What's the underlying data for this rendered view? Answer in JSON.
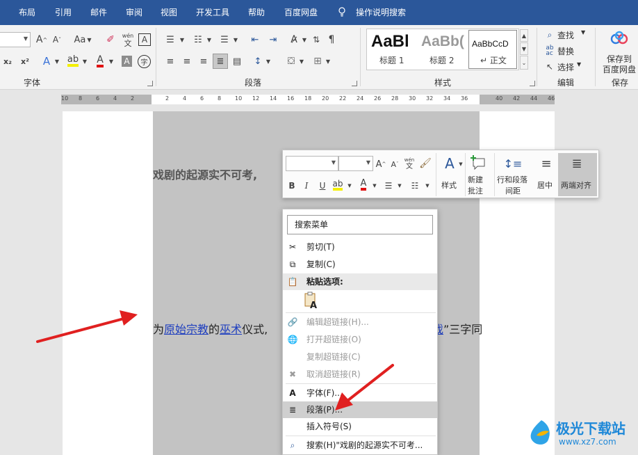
{
  "menu_tabs": [
    "布局",
    "引用",
    "邮件",
    "审阅",
    "视图",
    "开发工具",
    "帮助",
    "百度网盘"
  ],
  "tell_me": "操作说明搜索",
  "ribbon": {
    "groups": {
      "font": "字体",
      "paragraph": "段落",
      "styles": "样式",
      "editing": "编辑",
      "save": "保存"
    },
    "font_row1": {
      "grow": "A",
      "shrink": "A",
      "case": "Aa",
      "phonetic_top": "wén",
      "phonetic_bottom": "文",
      "border_char": "A"
    },
    "font_row2": {
      "subscript": "x₂",
      "superscript": "x²",
      "effects": "A",
      "font_color": "A",
      "shade": "A",
      "circle": "字"
    },
    "styles": [
      {
        "preview": "AaBl",
        "caption": "标题 1"
      },
      {
        "preview": "AaBb(",
        "caption": "标题 2"
      },
      {
        "preview": "AaBbCcD",
        "caption": "↵ 正文"
      }
    ],
    "editing": {
      "find": "查找",
      "replace": "替换",
      "select": "选择"
    },
    "save": {
      "line1": "保存到",
      "line2": "百度网盘"
    }
  },
  "ruler_ticks": [
    "10",
    "8",
    "6",
    "4",
    "2",
    "2",
    "4",
    "6",
    "8",
    "10",
    "12",
    "14",
    "16",
    "18",
    "20",
    "22",
    "24",
    "26",
    "28",
    "30",
    "32",
    "34",
    "36",
    "40",
    "42",
    "44",
    "46"
  ],
  "document": {
    "heading_fragment": "戏剧的起源实不可考,",
    "line2_prefix": "为",
    "link1": "原始宗教",
    "mid1": "的",
    "link2": "巫术",
    "mid2": "仪式,",
    "link3": "戏",
    "tail": "”三字同"
  },
  "mini_toolbar": {
    "bold": "B",
    "italic": "I",
    "underline": "U",
    "styles": "样式",
    "new_comment_1": "新建",
    "new_comment_2": "批注",
    "line_spacing_1": "行和段落",
    "line_spacing_2": "间距",
    "center": "居中",
    "justify": "两端对齐"
  },
  "context_menu": {
    "search_label": "搜索菜单",
    "items": [
      {
        "label": "剪切(T)",
        "icon": "scissors-icon",
        "disabled": false
      },
      {
        "label": "复制(C)",
        "icon": "copy-icon",
        "disabled": false
      },
      {
        "label": "粘贴选项:",
        "icon": "clipboard-icon",
        "disabled": false,
        "header": true
      },
      {
        "label": "编辑超链接(H)...",
        "icon": "edit-link-icon",
        "disabled": true
      },
      {
        "label": "打开超链接(O)",
        "icon": "open-link-icon",
        "disabled": true
      },
      {
        "label": "复制超链接(C)",
        "icon": "",
        "disabled": true
      },
      {
        "label": "取消超链接(R)",
        "icon": "remove-link-icon",
        "disabled": true
      },
      {
        "label": "字体(F)...",
        "icon": "font-icon",
        "disabled": false
      },
      {
        "label": "段落(P)...",
        "icon": "paragraph-icon",
        "disabled": false,
        "highlight": true
      },
      {
        "label": "插入符号(S)",
        "icon": "",
        "disabled": false
      },
      {
        "label": "搜索(H)\"戏剧的起源实不可考...",
        "icon": "search-icon",
        "disabled": false
      }
    ]
  },
  "watermark": {
    "name": "极光下载站",
    "url": "www.xz7.com"
  },
  "colors": {
    "title_bar": "#2b579a",
    "annotation_arrow": "#e02020",
    "link": "#1f3fbf"
  }
}
